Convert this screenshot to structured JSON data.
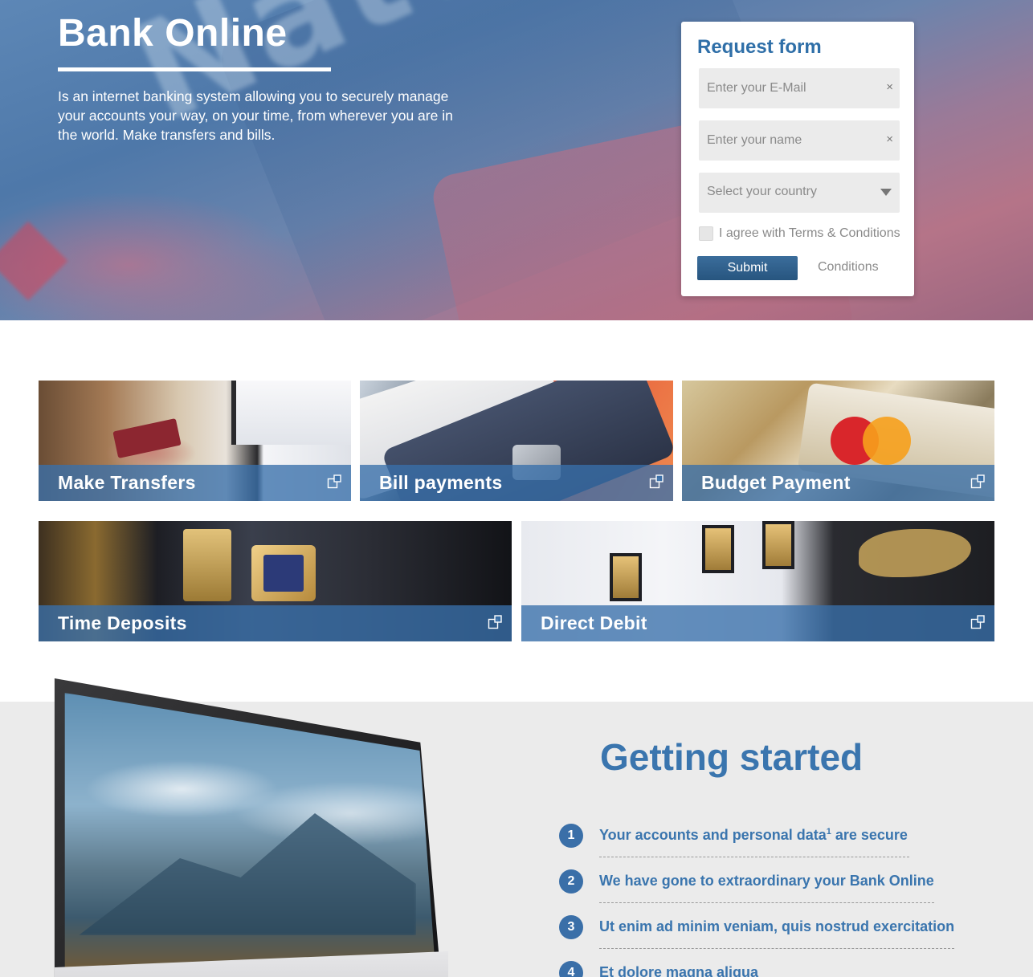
{
  "hero": {
    "title": "Bank Online",
    "description": "Is an internet banking system allowing you to securely manage your accounts your way, on your time, from wherever you are in the world. Make transfers and bills."
  },
  "request_form": {
    "title": "Request form",
    "email_placeholder": "Enter your E-Mail",
    "name_placeholder": "Enter your name",
    "country_placeholder": "Select your country",
    "clear_glyph": "×",
    "agree_label": "I agree with Terms & Conditions",
    "submit_label": "Submit",
    "conditions_link": "Conditions"
  },
  "services": [
    {
      "label": "Make Transfers",
      "icon": "external-link-icon"
    },
    {
      "label": "Bill payments",
      "icon": "external-link-icon"
    },
    {
      "label": "Budget Payment",
      "icon": "external-link-icon"
    },
    {
      "label": "Time Deposits",
      "icon": "external-link-icon"
    },
    {
      "label": "Direct Debit",
      "icon": "external-link-icon"
    }
  ],
  "getting_started": {
    "title": "Getting started",
    "steps": [
      {
        "number": "1",
        "text": "Your accounts and personal data",
        "superscript": "1",
        "text_after": " are secure"
      },
      {
        "number": "2",
        "text": "We have gone to extraordinary your Bank Online"
      },
      {
        "number": "3",
        "text": "Ut enim ad minim veniam, quis nostrud exercitation"
      },
      {
        "number": "4",
        "text": "Et dolore magna aliqua"
      }
    ]
  },
  "colors": {
    "accent": "#3a75ae",
    "button": "#2f5f8c",
    "tile_bar": "#3870aa",
    "section_bg": "#ebebeb"
  }
}
